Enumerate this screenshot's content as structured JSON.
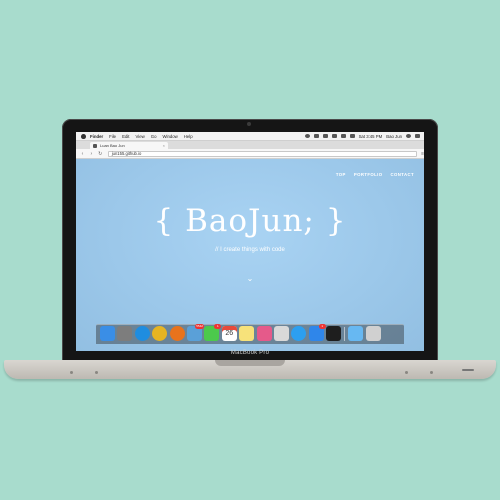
{
  "laptop": {
    "model_label": "MacBook Pro"
  },
  "menubar": {
    "app_name": "Finder",
    "items": [
      "File",
      "Edit",
      "View",
      "Go",
      "Window",
      "Help"
    ],
    "clock": "Sat 3:45 PM",
    "user": "Bao Jun"
  },
  "browser": {
    "tab_title": "Luan Bao Jun",
    "url": "jun155.github.io"
  },
  "page": {
    "nav": [
      "TOP",
      "PORTFOLIO",
      "CONTACT"
    ],
    "brand": "{ BaoJun; }",
    "tagline": "// I create things with code",
    "scroll_icon": "double-chevron-down-icon"
  },
  "dock": {
    "icons": [
      {
        "name": "finder-icon",
        "color": "#3a8ee6"
      },
      {
        "name": "launchpad-icon",
        "color": "#7d7d7d"
      },
      {
        "name": "safari-icon",
        "color": "#1f8de0"
      },
      {
        "name": "chrome-icon",
        "color": "#e6b422"
      },
      {
        "name": "firefox-icon",
        "color": "#e8731c"
      },
      {
        "name": "mail-icon",
        "color": "#5aa0d8",
        "badge": "5542"
      },
      {
        "name": "messages-icon",
        "color": "#4cc94c",
        "badge": "1"
      },
      {
        "name": "calendar-icon",
        "color": "#ffffff",
        "label": "26"
      },
      {
        "name": "notes-icon",
        "color": "#f7e27a"
      },
      {
        "name": "photos-icon",
        "color": "#e55a8a"
      },
      {
        "name": "finder-window-icon",
        "color": "#d9d9d9"
      },
      {
        "name": "chat-icon",
        "color": "#2c9ff0"
      },
      {
        "name": "app-store-icon",
        "color": "#2f86ea",
        "badge": "1"
      },
      {
        "name": "terminal-icon",
        "color": "#1e1e1e"
      },
      {
        "name": "folder-icon",
        "color": "#67b8f2"
      },
      {
        "name": "trash-icon",
        "color": "#d0d0d0"
      }
    ]
  }
}
